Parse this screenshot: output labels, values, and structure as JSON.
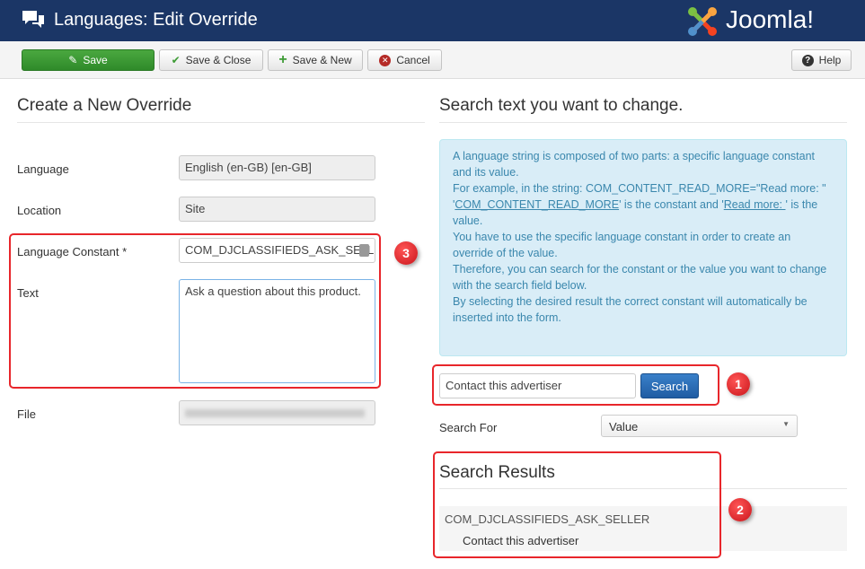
{
  "header": {
    "title": "Languages: Edit Override",
    "logo": "Joomla!",
    "icon": "comments-icon"
  },
  "toolbar": {
    "save": "Save",
    "save_close": "Save & Close",
    "save_new": "Save & New",
    "cancel": "Cancel",
    "help": "Help"
  },
  "left": {
    "heading": "Create a New Override",
    "fields": {
      "language_label": "Language",
      "language_value": "English (en-GB) [en-GB]",
      "location_label": "Location",
      "location_value": "Site",
      "constant_label": "Language Constant *",
      "constant_value": "COM_DJCLASSIFIEDS_ASK_SELLER",
      "text_label": "Text",
      "text_value": "Ask a question about this product.",
      "file_label": "File"
    }
  },
  "right": {
    "heading": "Search text you want to change.",
    "info": {
      "l1": "A language string is composed of two parts: a specific language constant and its value.",
      "l2": "For example, in the string: COM_CONTENT_READ_MORE=\"Read more: \"",
      "l3a": "'",
      "l3link1": "COM_CONTENT_READ_MORE",
      "l3b": "' is the constant and '",
      "l3link2": "Read more: ",
      "l3c": "' is the value.",
      "l4": "You have to use the specific language constant in order to create an override of the value.",
      "l5": "Therefore, you can search for the constant or the value you want to change with the search field below.",
      "l6": "By selecting the desired result the correct constant will automatically be inserted into the form."
    },
    "search_value": "Contact this advertiser",
    "search_button": "Search",
    "search_for_label": "Search For",
    "search_for_value": "Value",
    "results_heading": "Search Results",
    "result": {
      "constant": "COM_DJCLASSIFIEDS_ASK_SELLER",
      "value": "Contact this advertiser"
    }
  },
  "annotations": [
    "1",
    "2",
    "3"
  ],
  "colors": {
    "header": "#1b3666",
    "save": "#3d9b35",
    "primary": "#2a6ebb",
    "annotation": "#e8262b",
    "info_bg": "#d9edf7"
  }
}
